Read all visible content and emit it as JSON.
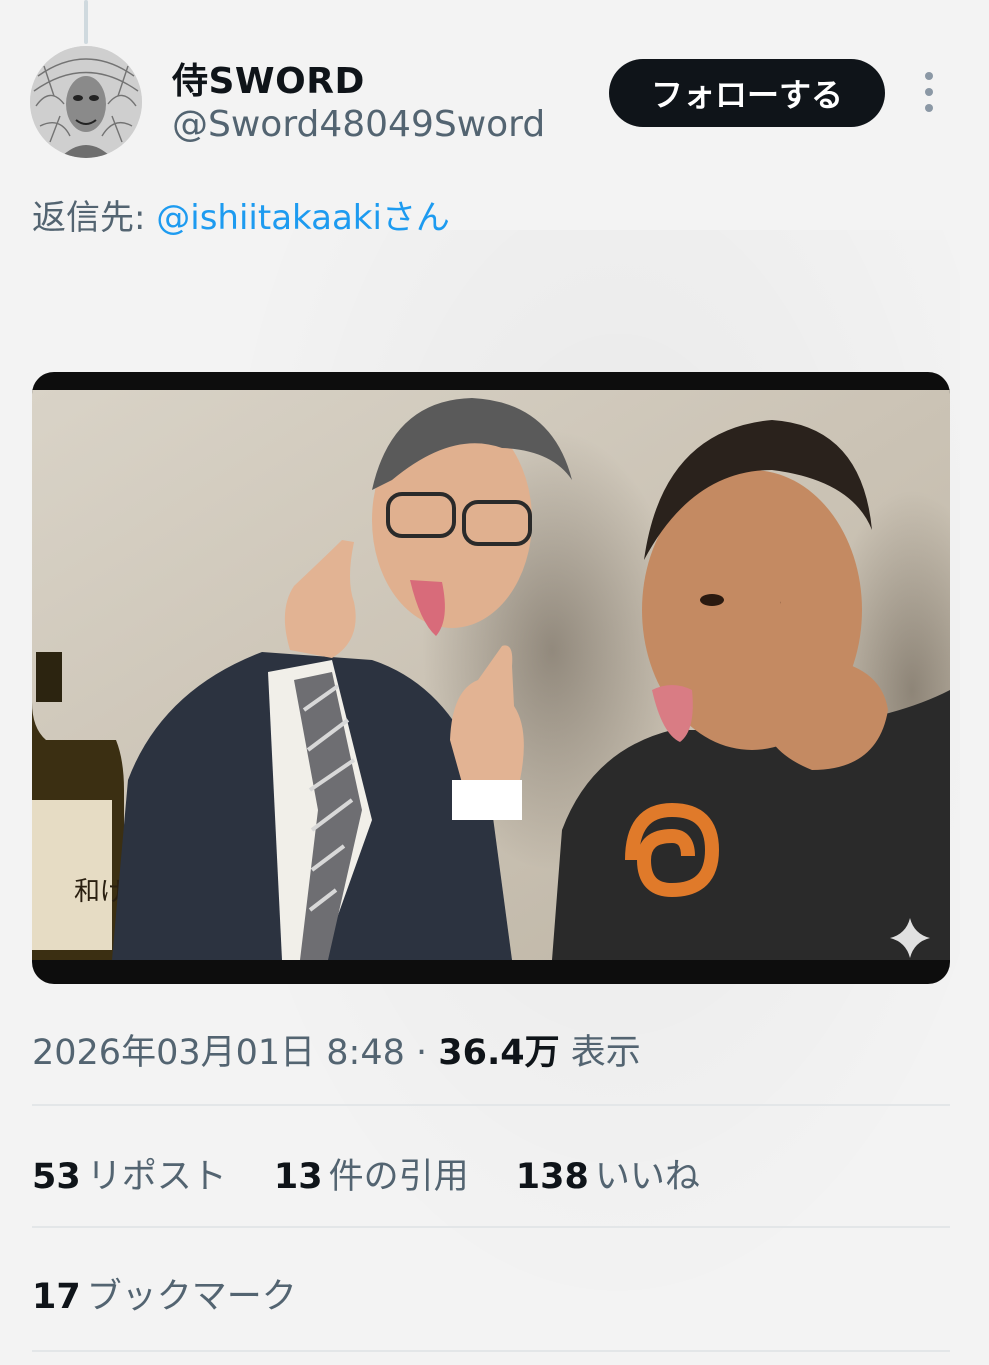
{
  "author": {
    "display_name": "侍SWORD",
    "handle": "@Sword48049Sword",
    "avatar_icon": "avatar-image"
  },
  "follow_button": {
    "label": "フォローする"
  },
  "more_menu": {
    "icon": "more-vertical-icon"
  },
  "reply": {
    "prefix": "返信先: ",
    "mention": "@ishiitakaaki",
    "suffix": "さん"
  },
  "media": {
    "bottle_label_text": "和げ",
    "sparkle_icon": "sparkle-icon"
  },
  "meta": {
    "datetime": "2026年03月01日 8:48",
    "separator": " · ",
    "views_count": "36.4万",
    "views_label": " 表示"
  },
  "stats": {
    "reposts_count": "53",
    "reposts_label": "リポスト",
    "quotes_count": "13",
    "quotes_label": "件の引用",
    "likes_count": "138",
    "likes_label": "いいね"
  },
  "bookmarks": {
    "count": "17",
    "label": "ブックマーク"
  },
  "colors": {
    "link": "#1d9bf0",
    "secondary_text": "#536471",
    "primary_text": "#0f1419",
    "button_bg": "#0f1419"
  }
}
